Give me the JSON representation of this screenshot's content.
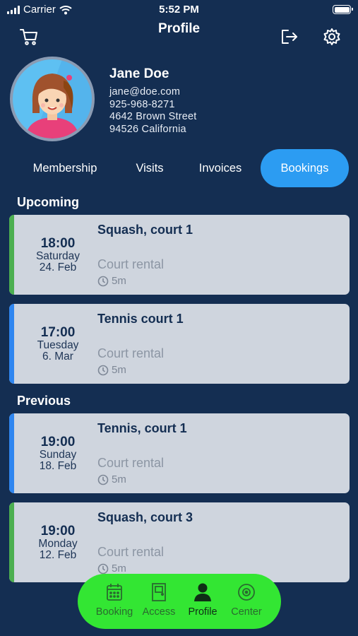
{
  "status_bar": {
    "carrier": "Carrier",
    "time": "5:52 PM"
  },
  "header": {
    "title": "Profile"
  },
  "icons": {
    "cart": "cart-icon",
    "logout": "logout-icon",
    "settings": "gear-icon",
    "duration": "clock-icon"
  },
  "profile": {
    "name": "Jane Doe",
    "email": "jane@doe.com",
    "phone": "925-968-8271",
    "street": "4642 Brown Street",
    "city": "94526 California"
  },
  "tabs": [
    {
      "label": "Membership",
      "active": false
    },
    {
      "label": "Visits",
      "active": false
    },
    {
      "label": "Invoices",
      "active": false
    },
    {
      "label": "Bookings",
      "active": true
    }
  ],
  "sections": {
    "upcoming": {
      "title": "Upcoming",
      "bookings": [
        {
          "time": "18:00",
          "day": "Saturday",
          "date": "24. Feb",
          "title": "Squash, court 1",
          "type": "Court rental",
          "duration": "5m",
          "color": "#4caf50"
        },
        {
          "time": "17:00",
          "day": "Tuesday",
          "date": "6. Mar",
          "title": "Tennis court 1",
          "type": "Court rental",
          "duration": "5m",
          "color": "#2f86f0"
        }
      ]
    },
    "previous": {
      "title": "Previous",
      "bookings": [
        {
          "time": "19:00",
          "day": "Sunday",
          "date": "18. Feb",
          "title": "Tennis, court 1",
          "type": "Court rental",
          "duration": "5m",
          "color": "#2f86f0"
        },
        {
          "time": "19:00",
          "day": "Monday",
          "date": "12. Feb",
          "title": "Squash, court 3",
          "type": "Court rental",
          "duration": "5m",
          "color": "#4caf50"
        }
      ]
    }
  },
  "bottom_nav": [
    {
      "label": "Booking",
      "icon": "calendar-icon",
      "active": false
    },
    {
      "label": "Access",
      "icon": "door-icon",
      "active": false
    },
    {
      "label": "Profile",
      "icon": "person-icon",
      "active": true
    },
    {
      "label": "Center",
      "icon": "target-icon",
      "active": false
    }
  ],
  "colors": {
    "background": "#142e52",
    "accent": "#2c9cf2",
    "card": "#cfd5de",
    "nav": "#33e633",
    "squash": "#4caf50",
    "tennis": "#2f86f0"
  }
}
